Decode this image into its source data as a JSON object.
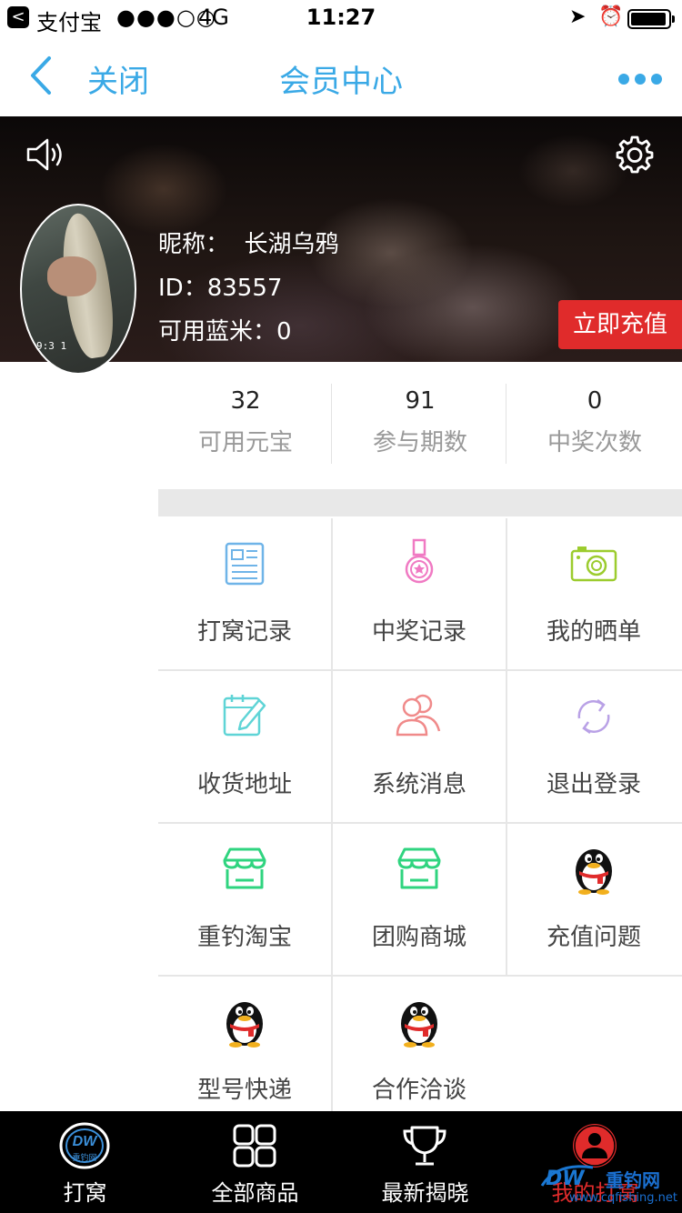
{
  "status_bar": {
    "back_glyph": "<",
    "app": "支付宝",
    "signal": "●●●○○",
    "network": "4G",
    "time": "11:27"
  },
  "nav": {
    "close_label": "关闭",
    "title": "会员中心",
    "accent_color": "#3aa9e6"
  },
  "profile": {
    "nickname_label": "昵称：",
    "nickname": "长湖乌鸦",
    "id_text": "ID：83557",
    "balance_text": "可用蓝米：0",
    "recharge_label": "立即充值",
    "avatar_timestamp": "9:3 1"
  },
  "stats": [
    {
      "value": "32",
      "label": "可用元宝"
    },
    {
      "value": "91",
      "label": "参与期数"
    },
    {
      "value": "0",
      "label": "中奖次数"
    }
  ],
  "menu": [
    {
      "label": "打窝记录",
      "icon": "document-icon",
      "color": "#6fb4e8"
    },
    {
      "label": "中奖记录",
      "icon": "medal-icon",
      "color": "#f07ac3"
    },
    {
      "label": "我的晒单",
      "icon": "camera-icon",
      "color": "#9ccc2e"
    },
    {
      "label": "收货地址",
      "icon": "edit-calendar-icon",
      "color": "#5fd4d6"
    },
    {
      "label": "系统消息",
      "icon": "users-icon",
      "color": "#f08a8a"
    },
    {
      "label": "退出登录",
      "icon": "refresh-icon",
      "color": "#b9a1e6"
    },
    {
      "label": "重钓淘宝",
      "icon": "store-icon",
      "color": "#2fd47f"
    },
    {
      "label": "团购商城",
      "icon": "store-icon",
      "color": "#2fd47f"
    },
    {
      "label": "充值问题",
      "icon": "qq-penguin-icon",
      "color": "#e02b2b"
    },
    {
      "label": "型号快递",
      "icon": "qq-penguin-icon",
      "color": "#e02b2b"
    },
    {
      "label": "合作洽谈",
      "icon": "qq-penguin-icon",
      "color": "#e02b2b"
    }
  ],
  "tabbar": [
    {
      "label": "打窝",
      "icon": "dw-logo-icon"
    },
    {
      "label": "全部商品",
      "icon": "grid-icon"
    },
    {
      "label": "最新揭晓",
      "icon": "trophy-icon"
    },
    {
      "label": "我的打窝",
      "icon": "profile-icon"
    }
  ],
  "watermark": {
    "logo": "DW",
    "site_name": "重钓网",
    "url": "www.cqfishing.net"
  }
}
